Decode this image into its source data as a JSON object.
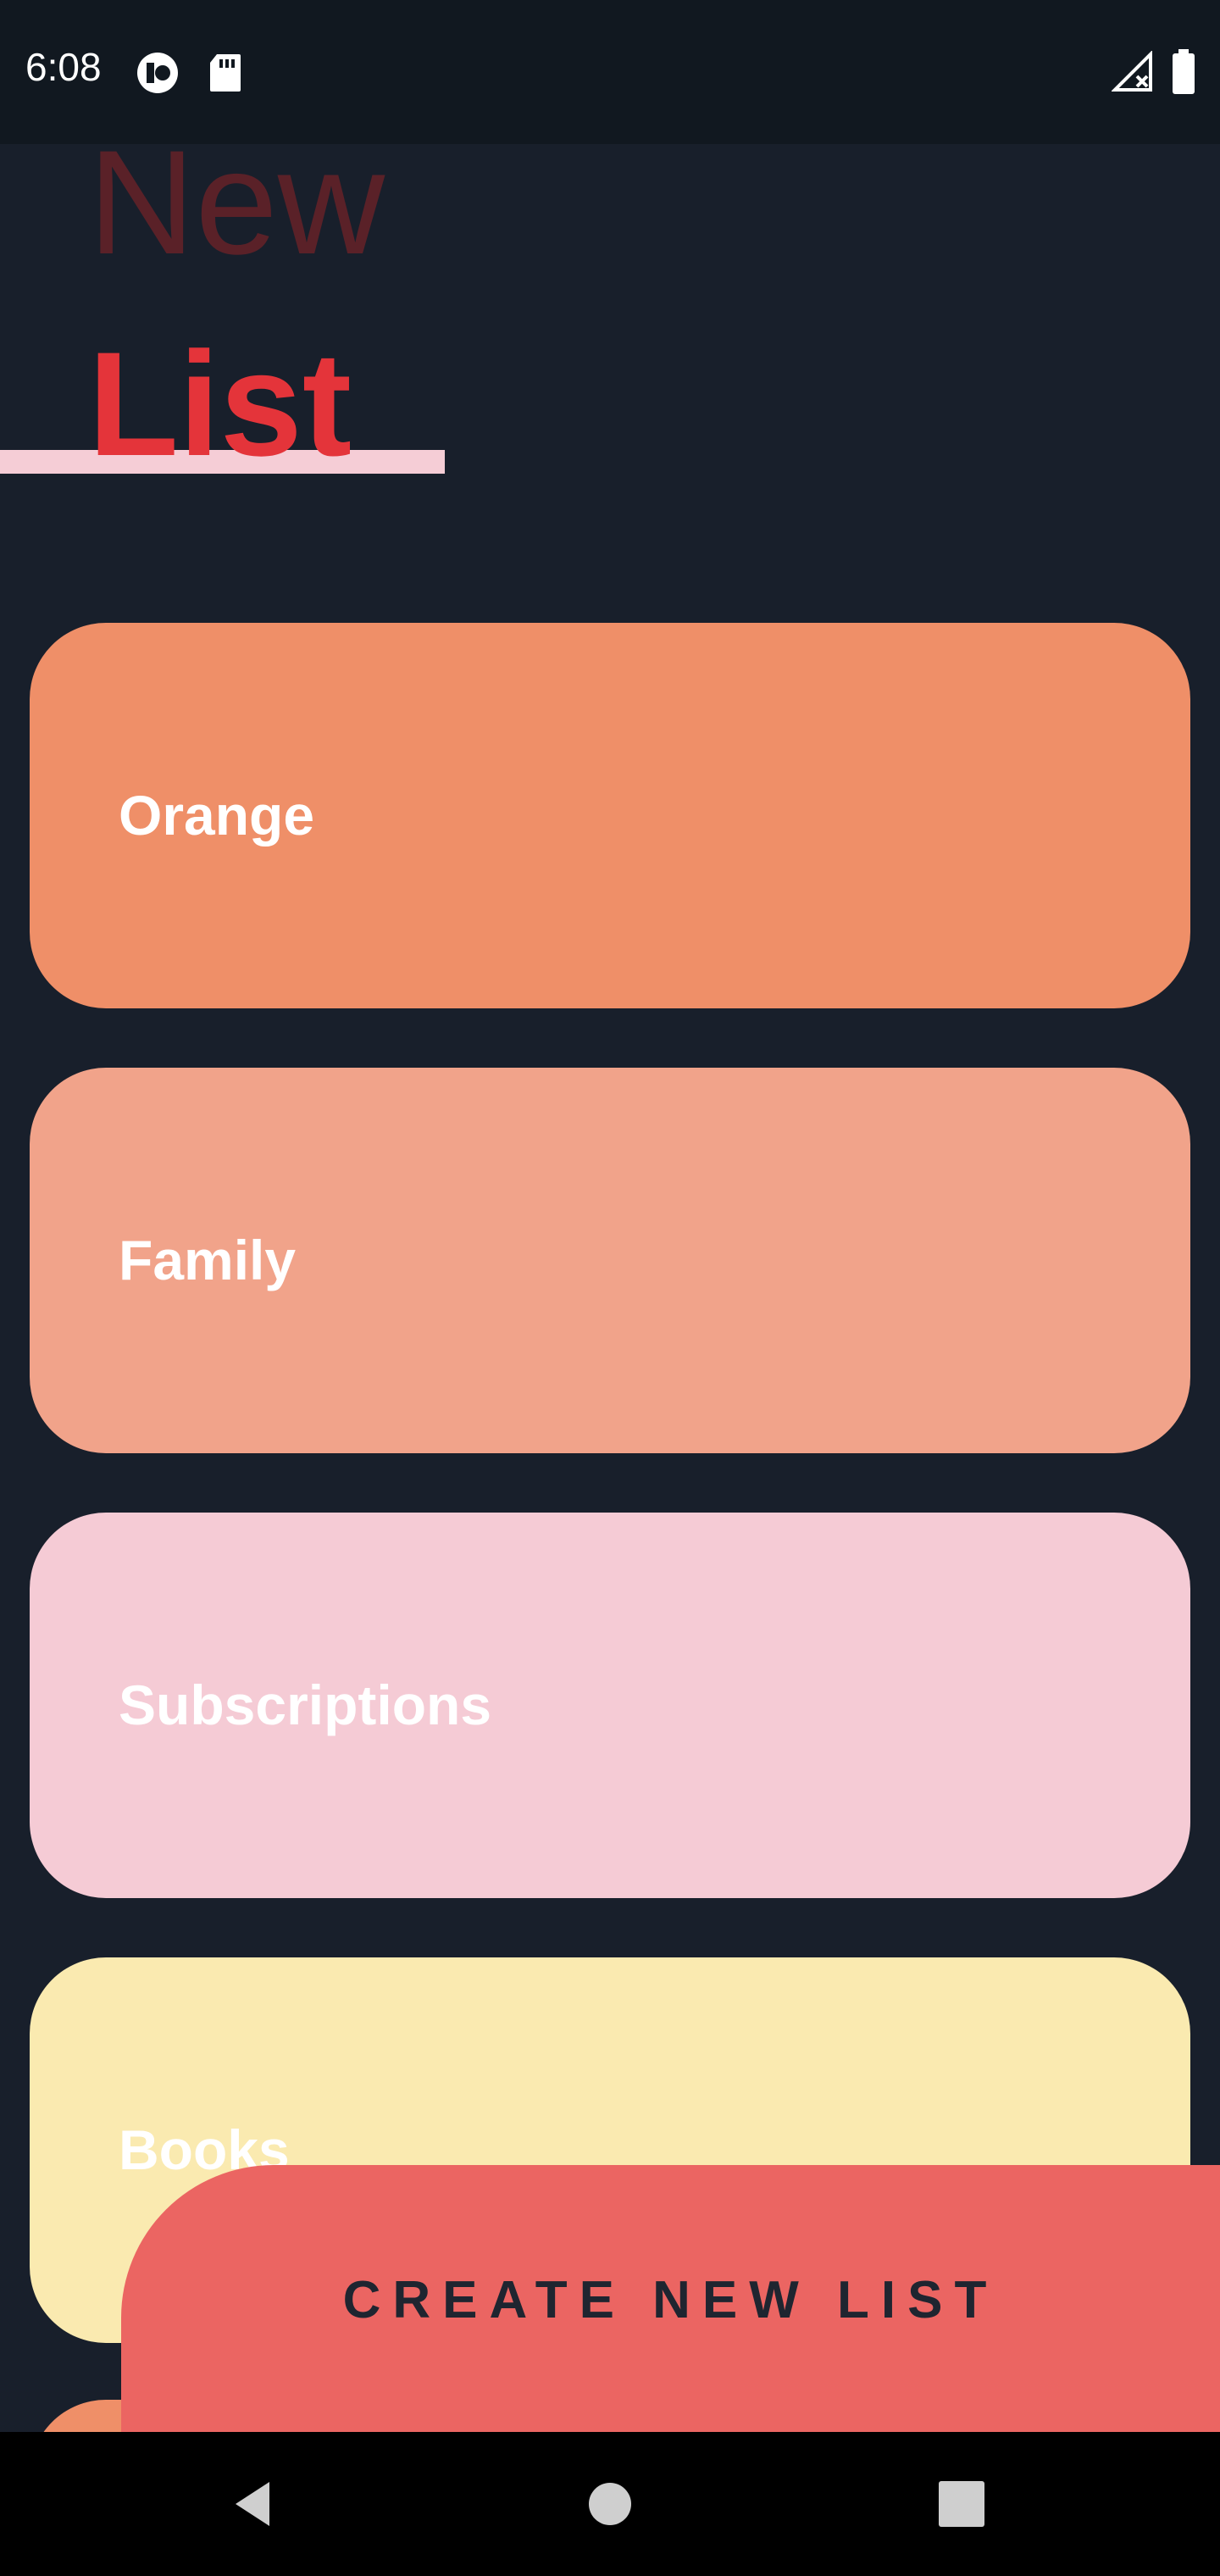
{
  "status_bar": {
    "time": "6:08",
    "icons": [
      "app-notification-icon",
      "sd-card-icon",
      "signal-no-service-icon",
      "battery-icon"
    ]
  },
  "header": {
    "line1": "New",
    "line2": "List"
  },
  "lists": [
    {
      "label": "Orange",
      "color": "#ef8f68"
    },
    {
      "label": "Family",
      "color": "#f1a38a"
    },
    {
      "label": "Subscriptions",
      "color": "#f5cbd5"
    },
    {
      "label": "Books",
      "color": "#faeab0"
    }
  ],
  "partial_card_color": "#ef8f68",
  "create_button": {
    "label": "CREATE NEW LIST",
    "color": "#eb6562"
  },
  "nav_bar": {
    "buttons": [
      "back-icon",
      "home-icon",
      "recents-icon"
    ]
  }
}
